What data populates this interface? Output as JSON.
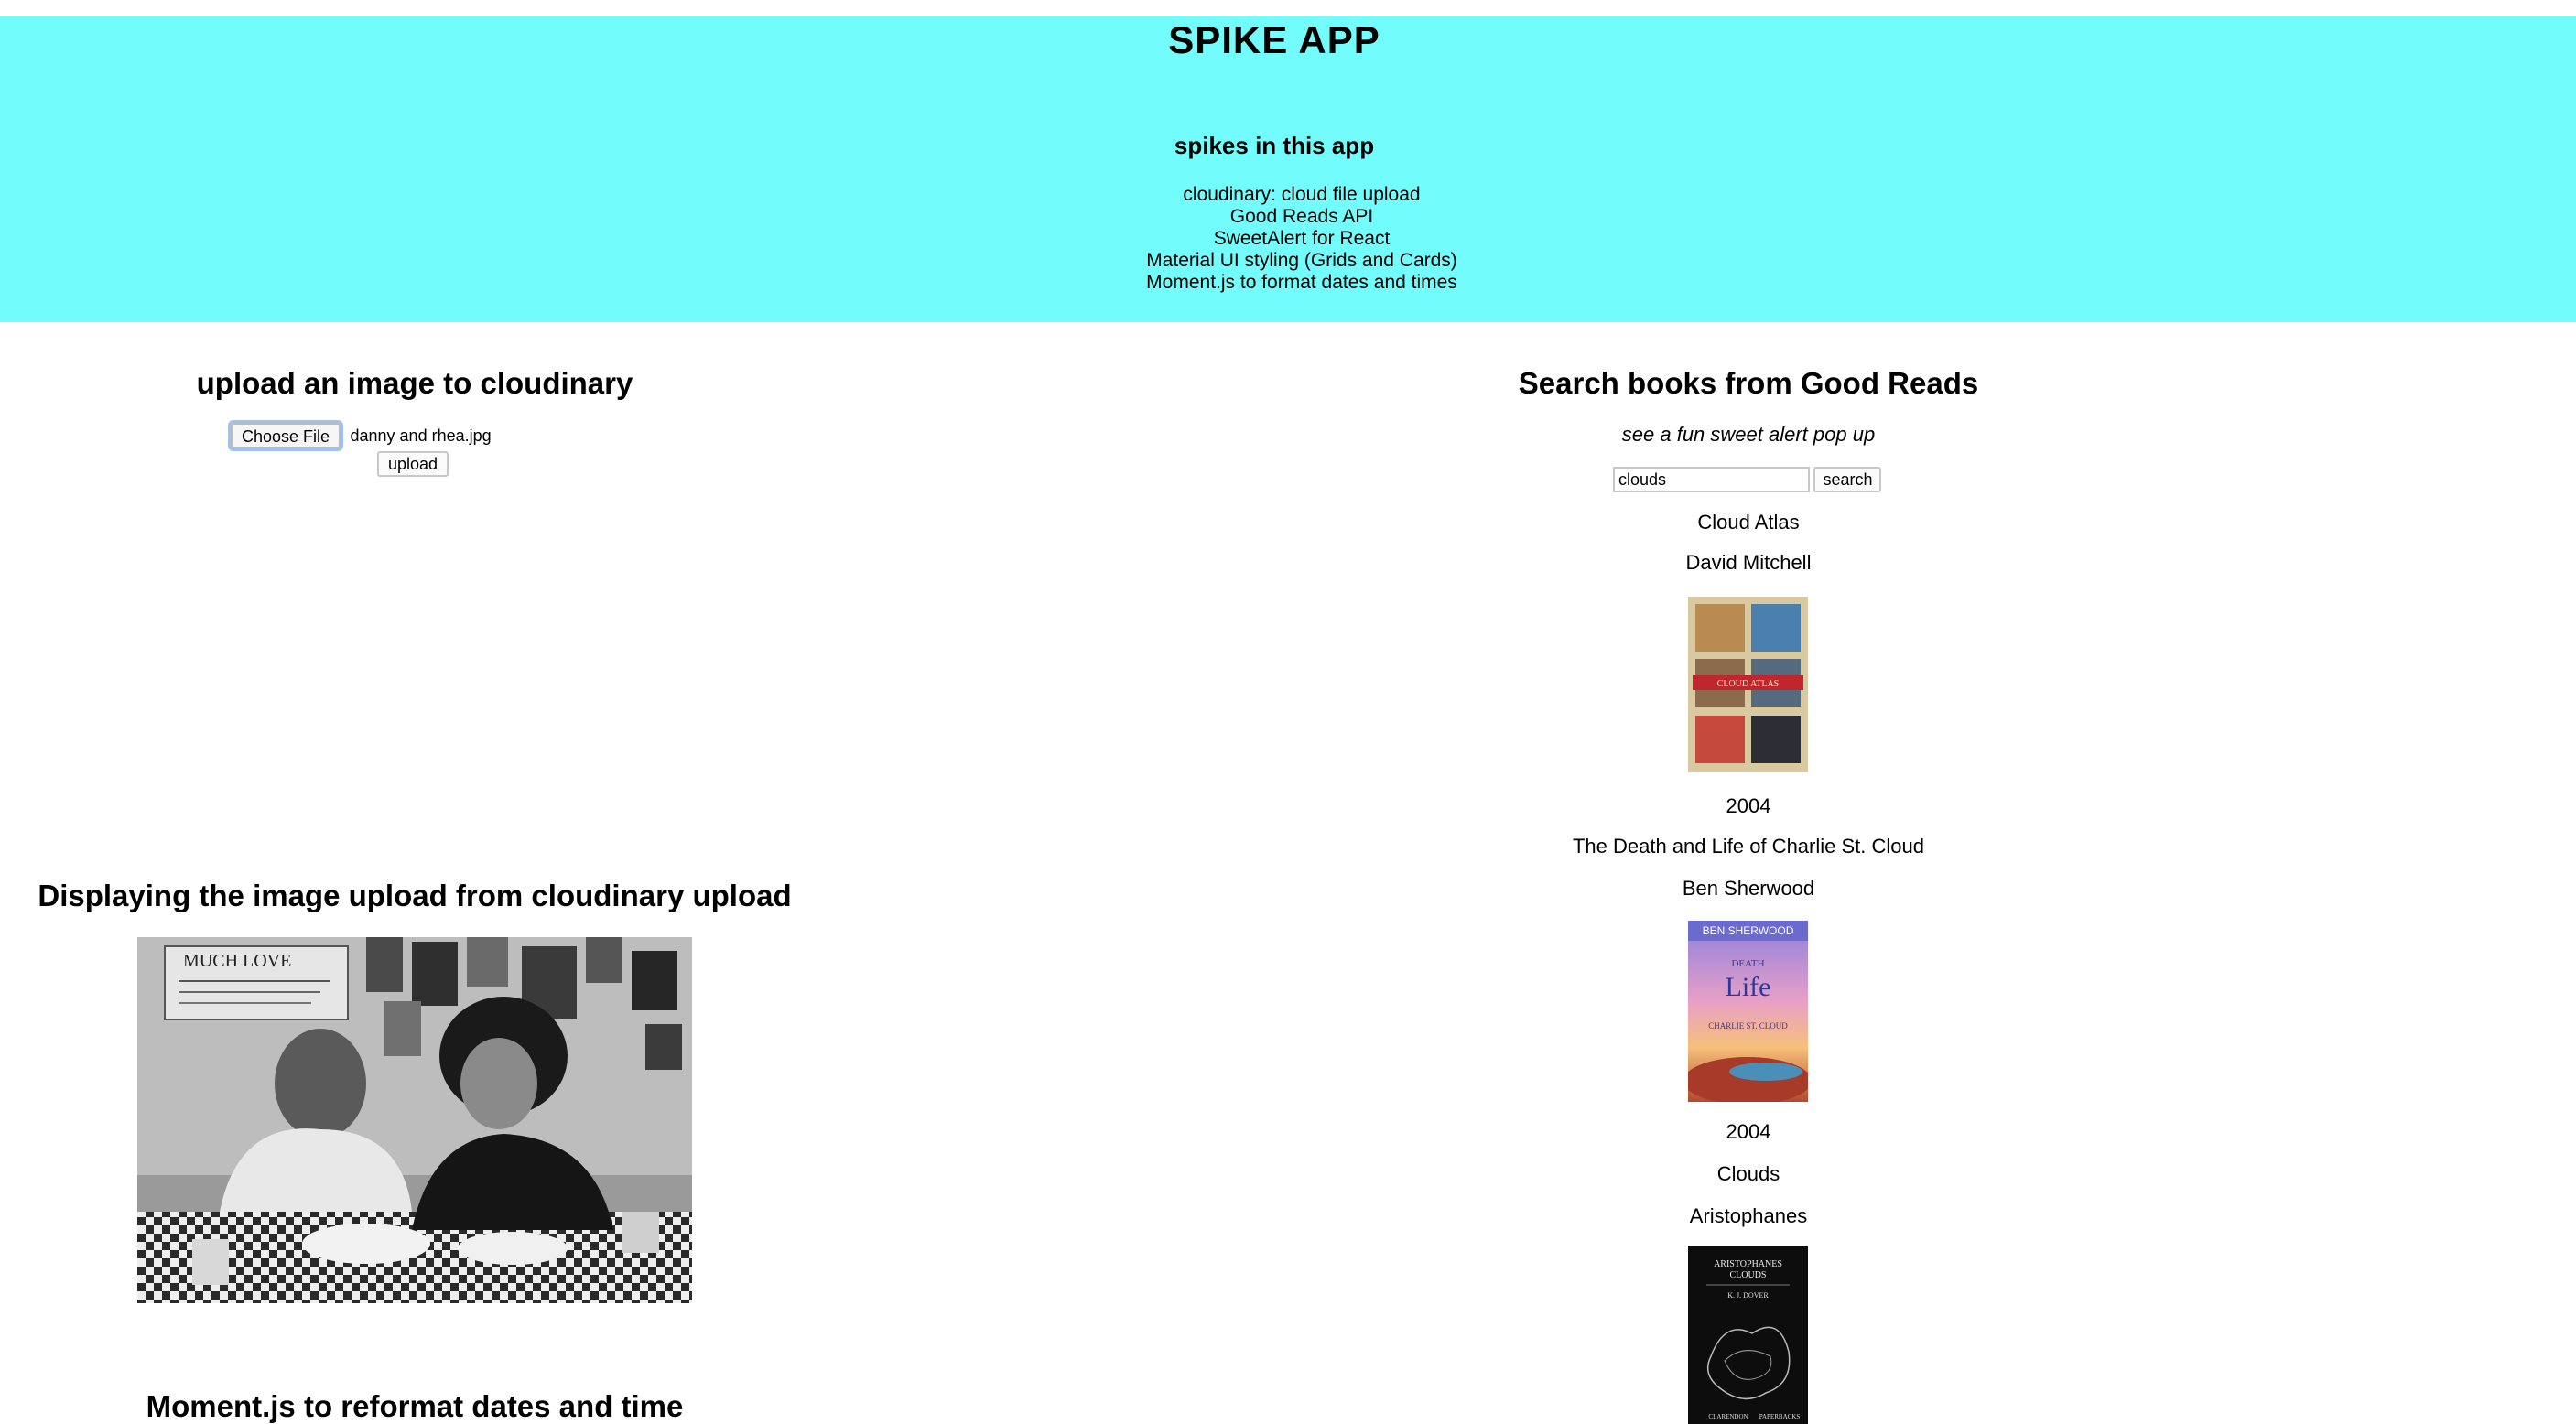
{
  "header": {
    "title": "SPIKE APP",
    "subtitle": "spikes in this app",
    "spikes": [
      "cloudinary: cloud file upload",
      "Good Reads API",
      "SweetAlert for React",
      "Material UI styling (Grids and Cards)",
      "Moment.js to format dates and times"
    ]
  },
  "upload": {
    "title": "upload an image to cloudinary",
    "choose_label": "Choose File",
    "file_name": "danny and rhea.jpg",
    "upload_label": "upload"
  },
  "display": {
    "title": "Displaying the image upload from cloudinary upload",
    "photo_sign": "MUCH LOVE"
  },
  "moment": {
    "title": "Moment.js to reformat dates and time"
  },
  "search": {
    "title": "Search books from Good Reads",
    "subtitle": "see a fun sweet alert pop up",
    "query": "clouds",
    "button_label": "search",
    "results": [
      {
        "title": "Cloud Atlas",
        "author": "David Mitchell",
        "year": "2004",
        "cover_text": "CLOUD ATLAS"
      },
      {
        "title": "The Death and Life of Charlie St. Cloud",
        "author": "Ben Sherwood",
        "year": "2004",
        "cover_text": [
          "BEN SHERWOOD",
          "DEATH",
          "Life",
          "CHARLIE ST. CLOUD"
        ]
      },
      {
        "title": "Clouds",
        "author": "Aristophanes",
        "cover_text": [
          "ARISTOPHANES",
          "CLOUDS",
          "K. J. DOVER",
          "CLARENDON",
          "PAPERBACKS"
        ]
      }
    ]
  },
  "colors": {
    "header_bg": "#72fcfb",
    "focus_ring": "#9cc2f5"
  }
}
